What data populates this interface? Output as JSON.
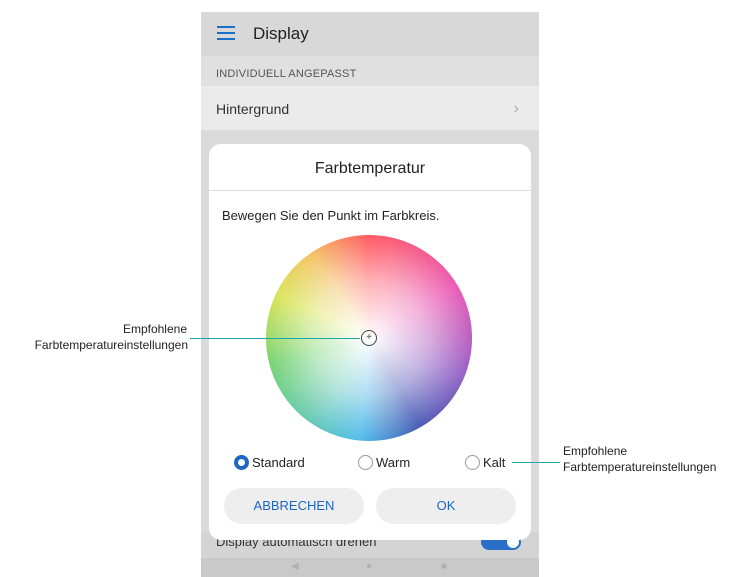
{
  "appbar": {
    "title": "Display"
  },
  "section": {
    "label": "INDIVIDUELL ANGEPASST"
  },
  "row": {
    "label": "Hintergrund",
    "chevron": "›"
  },
  "bottom_row": {
    "label": "Display automatisch drehen"
  },
  "nav": {
    "back": "◀",
    "home": "●",
    "recents": "■"
  },
  "dialog": {
    "title": "Farbtemperatur",
    "instruction": "Bewegen Sie den Punkt im Farbkreis.",
    "marker": "+",
    "options": [
      {
        "label": "Standard",
        "selected": true
      },
      {
        "label": "Warm",
        "selected": false
      },
      {
        "label": "Kalt",
        "selected": false
      }
    ],
    "cancel": "ABBRECHEN",
    "ok": "OK"
  },
  "callouts": {
    "left": {
      "line1": "Empfohlene",
      "line2": "Farbtemperatureinstellungen"
    },
    "right": {
      "line1": "Empfohlene",
      "line2": "Farbtemperatureinstellungen"
    }
  },
  "colors": {
    "accent": "#1f66c4",
    "callout_line": "#1fa7a7",
    "toggle_on": "#2a6fc7"
  }
}
